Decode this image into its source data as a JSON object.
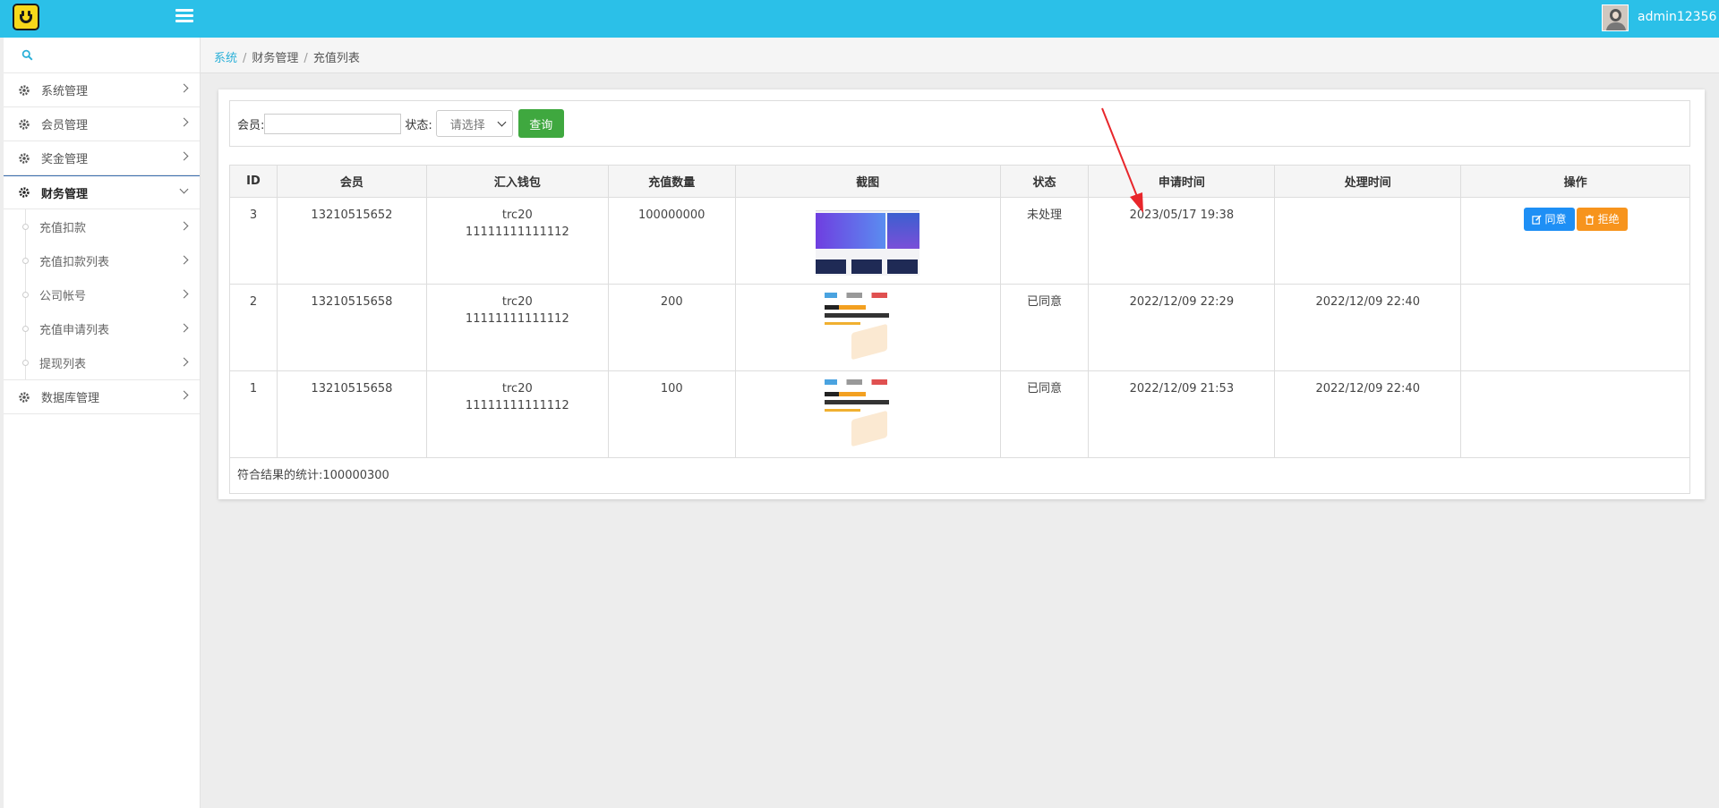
{
  "header": {
    "username": "admin12356"
  },
  "sidebar": {
    "items": [
      {
        "label": "系统管理"
      },
      {
        "label": "会员管理"
      },
      {
        "label": "奖金管理"
      },
      {
        "label": "财务管理"
      },
      {
        "label": "数据库管理"
      }
    ],
    "sub_items": [
      {
        "label": "充值扣款"
      },
      {
        "label": "充值扣款列表"
      },
      {
        "label": "公司帐号"
      },
      {
        "label": "充值申请列表"
      },
      {
        "label": "提现列表"
      }
    ]
  },
  "breadcrumb": {
    "root": "系统",
    "section": "财务管理",
    "current": "充值列表",
    "sep": "/"
  },
  "filter": {
    "member_label": "会员:",
    "status_label": "状态:",
    "status_selected": "请选择",
    "query_label": "查询"
  },
  "table": {
    "headers": [
      "ID",
      "会员",
      "汇入钱包",
      "充值数量",
      "截图",
      "状态",
      "申请时间",
      "处理时间",
      "操作"
    ],
    "rows": [
      {
        "id": "3",
        "member": "13210515652",
        "wallet_type": "trc20",
        "wallet_addr": "11111111111112",
        "amount": "100000000",
        "status": "未处理",
        "apply_time": "2023/05/17 19:38",
        "process_time": ""
      },
      {
        "id": "2",
        "member": "13210515658",
        "wallet_type": "trc20",
        "wallet_addr": "11111111111112",
        "amount": "200",
        "status": "已同意",
        "apply_time": "2022/12/09 22:29",
        "process_time": "2022/12/09 22:40"
      },
      {
        "id": "1",
        "member": "13210515658",
        "wallet_type": "trc20",
        "wallet_addr": "11111111111112",
        "amount": "100",
        "status": "已同意",
        "apply_time": "2022/12/09 21:53",
        "process_time": "2022/12/09 22:40"
      }
    ],
    "agree_label": "同意",
    "reject_label": "拒绝",
    "summary": "符合结果的统计:100000300"
  },
  "colors": {
    "topbar": "#2bc0e8",
    "agree": "#1e8ff5",
    "reject": "#f7941d",
    "query": "#3fa83f",
    "annotation_arrow": "#e8262b"
  }
}
